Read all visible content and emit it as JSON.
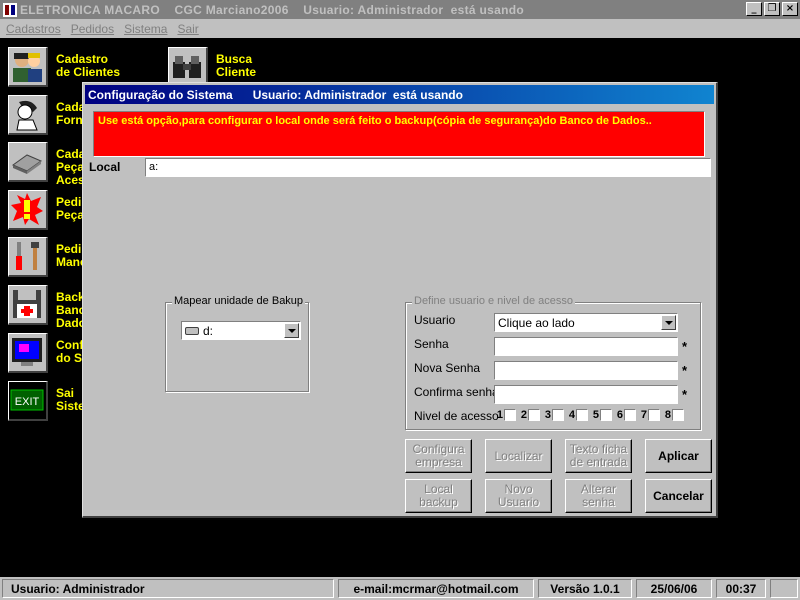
{
  "window": {
    "title": "ELETRONICA MACARO    CGC Marciano2006    Usuario: Administrador  está usando",
    "buttons": [
      "_",
      "❐",
      "×"
    ]
  },
  "menu": [
    "Cadastros",
    "Pedidos",
    "Sistema",
    "Sair"
  ],
  "launcher": [
    {
      "label": "Cadastro\nde Clientes",
      "icon": "customers-icon"
    },
    {
      "label": "Busca\nCliente",
      "icon": "binoculars-icon"
    },
    {
      "label": "Cada\nForn",
      "icon": "phone-person-icon"
    },
    {
      "label": "Cada\nPeça\nAces",
      "icon": "chip-icon"
    },
    {
      "label": "Pedi\nPeça",
      "icon": "alert-icon"
    },
    {
      "label": "Pedi\nMano",
      "icon": "tools-icon"
    },
    {
      "label": "Back\nBanc\nDado",
      "icon": "floppy-icon"
    },
    {
      "label": "Conf\ndo S",
      "icon": "monitor-icon"
    },
    {
      "label": "Sai\nSiste",
      "icon": "exit-icon"
    }
  ],
  "dialog": {
    "title": "Configuração do Sistema      Usuario: Administrador  está usando",
    "warning": "Use está opção,para configurar o local onde será feito o backup(cópia de segurança)do Banco de Dados..",
    "local_label": "Local",
    "local_value": "a:",
    "backup_group": {
      "legend": "Mapear unidade de Bakup",
      "drive": "d:"
    },
    "user_group": {
      "legend": "Define usuario e nivel de acesso",
      "usuario_label": "Usuario",
      "usuario_value": "Clique ao lado",
      "senha_label": "Senha",
      "nova_senha_label": "Nova Senha",
      "confirma_label": "Confirma senha",
      "nivel_label": "Nivel de acesso",
      "required_mark": "*",
      "levels": [
        "1",
        "2",
        "3",
        "4",
        "5",
        "6",
        "7",
        "8"
      ]
    },
    "buttons": {
      "configura": "Configura\nempresa",
      "localizar": "Localizar",
      "texto": "Texto ficha\nde entrada",
      "aplicar": "Aplicar",
      "local_backup": "Local\nbackup",
      "novo_usuario": "Novo\nUsuario",
      "alterar_senha": "Alterar\nsenha",
      "cancelar": "Cancelar"
    }
  },
  "status": {
    "user": "Usuario: Administrador",
    "email": "e-mail:mcrmar@hotmail.com",
    "version": "Versão 1.0.1",
    "date": "25/06/06",
    "time": "00:37"
  }
}
